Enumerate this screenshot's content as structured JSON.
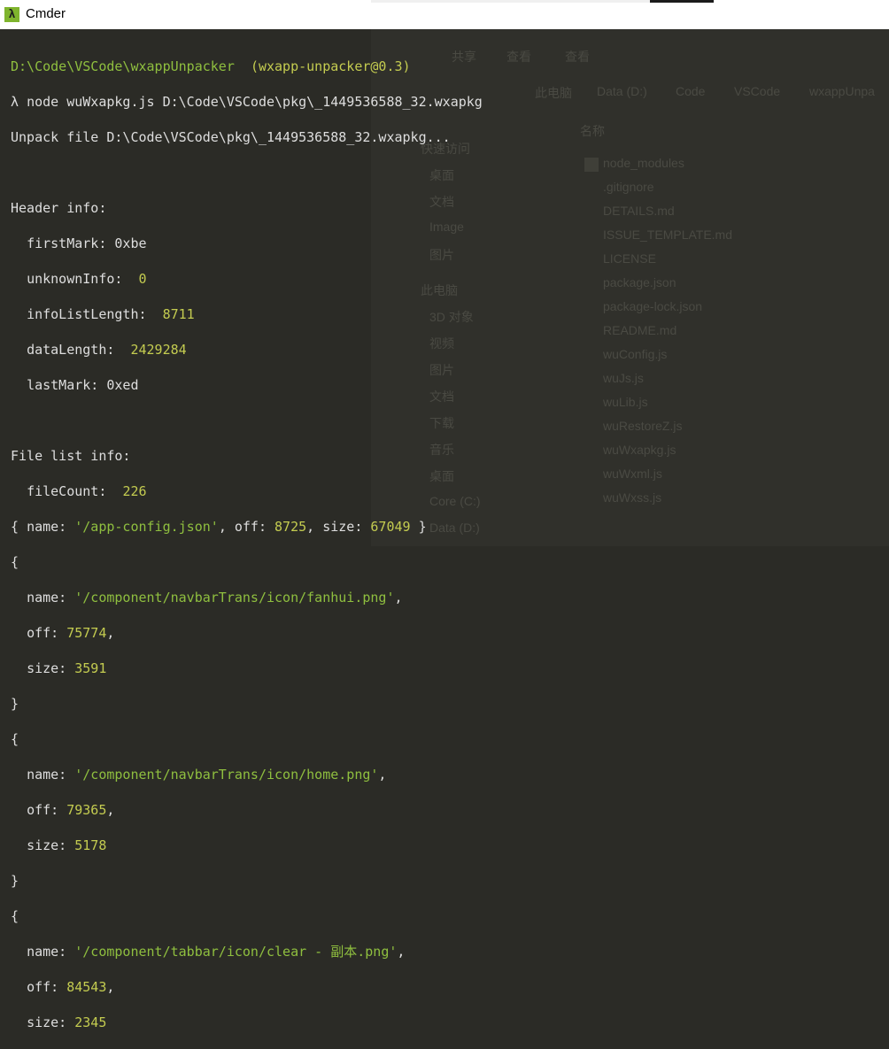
{
  "window": {
    "title": "Cmder"
  },
  "background_explorer": {
    "ribbon": [
      "共享",
      "查看"
    ],
    "breadcrumb": [
      "此电脑",
      "Data (D:)",
      "Code",
      "VSCode",
      "wxappUnpa"
    ],
    "column_header": "名称",
    "nav": [
      "快速访问",
      "桌面",
      "文档",
      "Image",
      "图片",
      "此电脑",
      "3D 对象",
      "视频",
      "图片",
      "文档",
      "下载",
      "音乐",
      "桌面",
      "Core (C:)",
      "Data (D:)"
    ],
    "files": [
      "node_modules",
      ".gitignore",
      "DETAILS.md",
      "ISSUE_TEMPLATE.md",
      "LICENSE",
      "package.json",
      "package-lock.json",
      "README.md",
      "wuConfig.js",
      "wuJs.js",
      "wuLib.js",
      "wuRestoreZ.js",
      "wuWxapkg.js",
      "wuWxml.js",
      "wuWxss.js"
    ]
  },
  "terminal": {
    "prompt_path": "D:\\Code\\VSCode\\wxappUnpacker",
    "prompt_pkg": "(wxapp-unpacker@0.3)",
    "prompt_symbol": "λ",
    "command": "node wuWxapkg.js D:\\Code\\VSCode\\pkg\\_1449536588_32.wxapkg",
    "unpack_line": "Unpack file D:\\Code\\VSCode\\pkg\\_1449536588_32.wxapkg...",
    "header_title": "Header info:",
    "first_mark_key": "firstMark:",
    "first_mark_val": "0xbe",
    "unknown_info_key": "unknownInfo:",
    "unknown_info_val": "0",
    "info_list_length_key": "infoListLength:",
    "info_list_length_val": "8711",
    "data_length_key": "dataLength:",
    "data_length_val": "2429284",
    "last_mark_key": "lastMark:",
    "last_mark_val": "0xed",
    "file_list_title": "File list info:",
    "file_count_key": "fileCount:",
    "file_count_val": "226",
    "entry0": {
      "name": "'/app-config.json'",
      "off": "8725",
      "size": "67049"
    },
    "entry1": {
      "name": "'/component/navbarTrans/icon/fanhui.png'",
      "off": "75774",
      "size": "3591"
    },
    "entry2": {
      "name": "'/component/navbarTrans/icon/home.png'",
      "off": "79365",
      "size": "5178"
    },
    "entry3": {
      "name": "'/component/tabbar/icon/clear - 副本.png'",
      "off": "84543",
      "size": "2345"
    },
    "lbl_name": "name:",
    "lbl_off": "off:",
    "lbl_size": "size:"
  },
  "colors": {
    "titlebar": "#ffffff",
    "terminal_bg": "#2b2b26",
    "text": "#dedede",
    "yellow": "#c4cc50",
    "green": "#8fbf3f"
  }
}
